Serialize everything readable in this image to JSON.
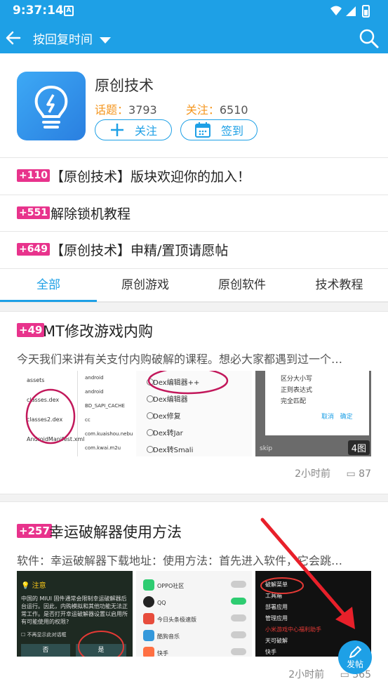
{
  "status": {
    "time": "9:37:14",
    "notif_icon": "A"
  },
  "appbar": {
    "sort_label": "按回复时间"
  },
  "forum": {
    "name": "原创技术",
    "topics_label": "话题：",
    "topics_value": "3793",
    "follows_label": "关注：",
    "follows_value": "6510",
    "follow_button": "关注",
    "checkin_button": "签到"
  },
  "pinned": [
    {
      "badge": "+110",
      "title": "【原创技术】版块欢迎你的加入！"
    },
    {
      "badge": "+551",
      "title": "解除锁机教程"
    },
    {
      "badge": "+649",
      "title": "【原创技术】申精/置顶请愿帖"
    }
  ],
  "tabs": [
    "全部",
    "原创游戏",
    "原创软件",
    "技术教程"
  ],
  "posts": [
    {
      "badge": "+49",
      "title": "MT修改游戏内购",
      "excerpt": "今天我们来讲有关支付内购破解的课程。想必大家都遇到过一个…",
      "time": "2小时前",
      "comments": "87",
      "image_count": "4图",
      "thumb1_lines": [
        "assets",
        "classes.dex",
        "classes2.dex",
        "AndroidManifest.xml"
      ],
      "thumb1_right": [
        "android",
        "android",
        "BD_SAPI_CACHE",
        "cc",
        "com.kuaishou.nebul",
        "com.kwai.m2u"
      ],
      "thumb2_lines": [
        "Dex编辑器++",
        "Dex编辑器",
        "Dex修复",
        "Dex转Jar",
        "Dex转Smali"
      ],
      "thumb3_lines": [
        "区分大小写",
        "正则表达式",
        "完全匹配"
      ],
      "thumb3_actions": [
        "取消",
        "确定"
      ],
      "thumb3_extra": "skip"
    },
    {
      "badge": "+257",
      "title": "幸运破解器使用方法",
      "excerpt": "软件：幸运破解器下载地址：使用方法：首先进入软件，它会跳…",
      "time": "2小时前",
      "comments": "365",
      "thumb1_title": "注意",
      "thumb1_text": "中国的 MIUI 固件通常会限制幸运破解器后台运行。因此，内购模拟和其他功能无法正常工作。是否打开幸运破解器设置以启用所有可能使用的权限?",
      "thumb1_checkbox": "不再显示此对话框",
      "thumb1_btn_no": "否",
      "thumb1_btn_yes": "是",
      "thumb2_lines": [
        "OPPO社区",
        "QQ",
        "今日头条极速版",
        "酷狗音乐",
        "快手"
      ],
      "thumb3_lines": [
        "破解菜单",
        "工具箱",
        "部署应用",
        "管理应用",
        "小米游戏中心福利助手",
        "天可破解",
        "快手"
      ]
    }
  ],
  "fab": {
    "label": "发帖"
  },
  "colors": {
    "primary": "#1ea0e6",
    "badge": "#e8338c",
    "accent": "#f5961e"
  }
}
